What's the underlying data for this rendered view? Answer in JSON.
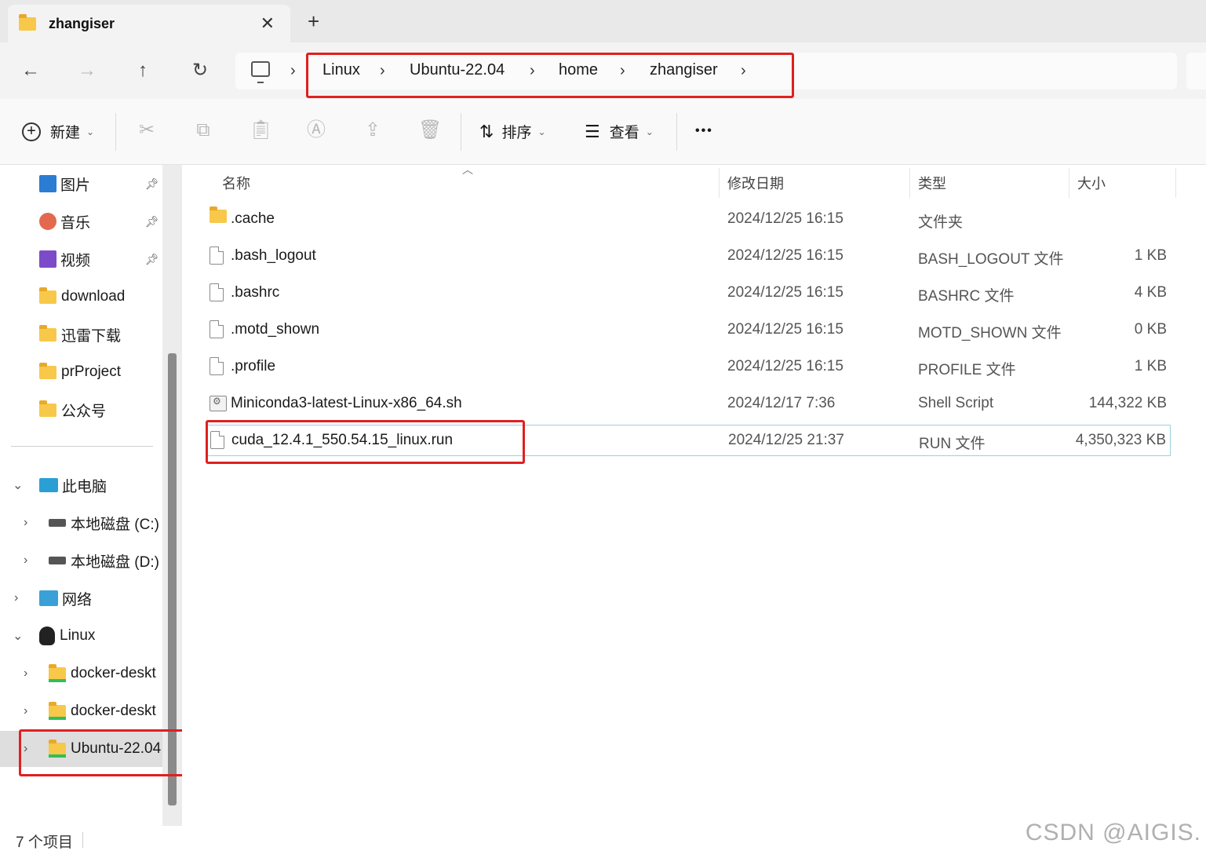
{
  "tab": {
    "title": "zhangiser",
    "close": "✕",
    "add": "+"
  },
  "nav": {
    "back": "←",
    "forward": "→",
    "up": "↑",
    "refresh": "↻",
    "breadcrumbs": [
      "Linux",
      "Ubuntu-22.04",
      "home",
      "zhangiser"
    ],
    "sep": "›"
  },
  "toolbar": {
    "new_label": "新建",
    "sort_label": "排序",
    "view_label": "查看",
    "more": "•••"
  },
  "sidebar": {
    "quick": [
      {
        "label": "图片",
        "icon": "pictures-icon"
      },
      {
        "label": "音乐",
        "icon": "music-icon"
      },
      {
        "label": "视频",
        "icon": "videos-icon"
      },
      {
        "label": "download",
        "icon": "folder-icon"
      },
      {
        "label": "迅雷下载",
        "icon": "folder-icon"
      },
      {
        "label": "prProject",
        "icon": "folder-icon"
      },
      {
        "label": "公众号",
        "icon": "folder-icon"
      }
    ],
    "tree": [
      {
        "label": "此电脑"
      },
      {
        "label": "本地磁盘 (C:)"
      },
      {
        "label": "本地磁盘 (D:)"
      },
      {
        "label": "网络"
      },
      {
        "label": "Linux"
      },
      {
        "label": "docker-deskt"
      },
      {
        "label": "docker-deskt"
      },
      {
        "label": "Ubuntu-22.04"
      }
    ]
  },
  "columns": {
    "name": "名称",
    "date": "修改日期",
    "type": "类型",
    "size": "大小"
  },
  "files": [
    {
      "name": ".cache",
      "date": "2024/12/25 16:15",
      "type": "文件夹",
      "size": "",
      "kind": "folder"
    },
    {
      "name": ".bash_logout",
      "date": "2024/12/25 16:15",
      "type": "BASH_LOGOUT 文件",
      "size": "1 KB",
      "kind": "file"
    },
    {
      "name": ".bashrc",
      "date": "2024/12/25 16:15",
      "type": "BASHRC 文件",
      "size": "4 KB",
      "kind": "file"
    },
    {
      "name": ".motd_shown",
      "date": "2024/12/25 16:15",
      "type": "MOTD_SHOWN 文件",
      "size": "0 KB",
      "kind": "file"
    },
    {
      "name": ".profile",
      "date": "2024/12/25 16:15",
      "type": "PROFILE 文件",
      "size": "1 KB",
      "kind": "file"
    },
    {
      "name": "Miniconda3-latest-Linux-x86_64.sh",
      "date": "2024/12/17 7:36",
      "type": "Shell Script",
      "size": "144,322 KB",
      "kind": "script"
    },
    {
      "name": "cuda_12.4.1_550.54.15_linux.run",
      "date": "2024/12/25 21:37",
      "type": "RUN 文件",
      "size": "4,350,323 KB",
      "kind": "file"
    }
  ],
  "status": {
    "count": "7 个项目"
  },
  "watermark": "CSDN @AIGIS."
}
